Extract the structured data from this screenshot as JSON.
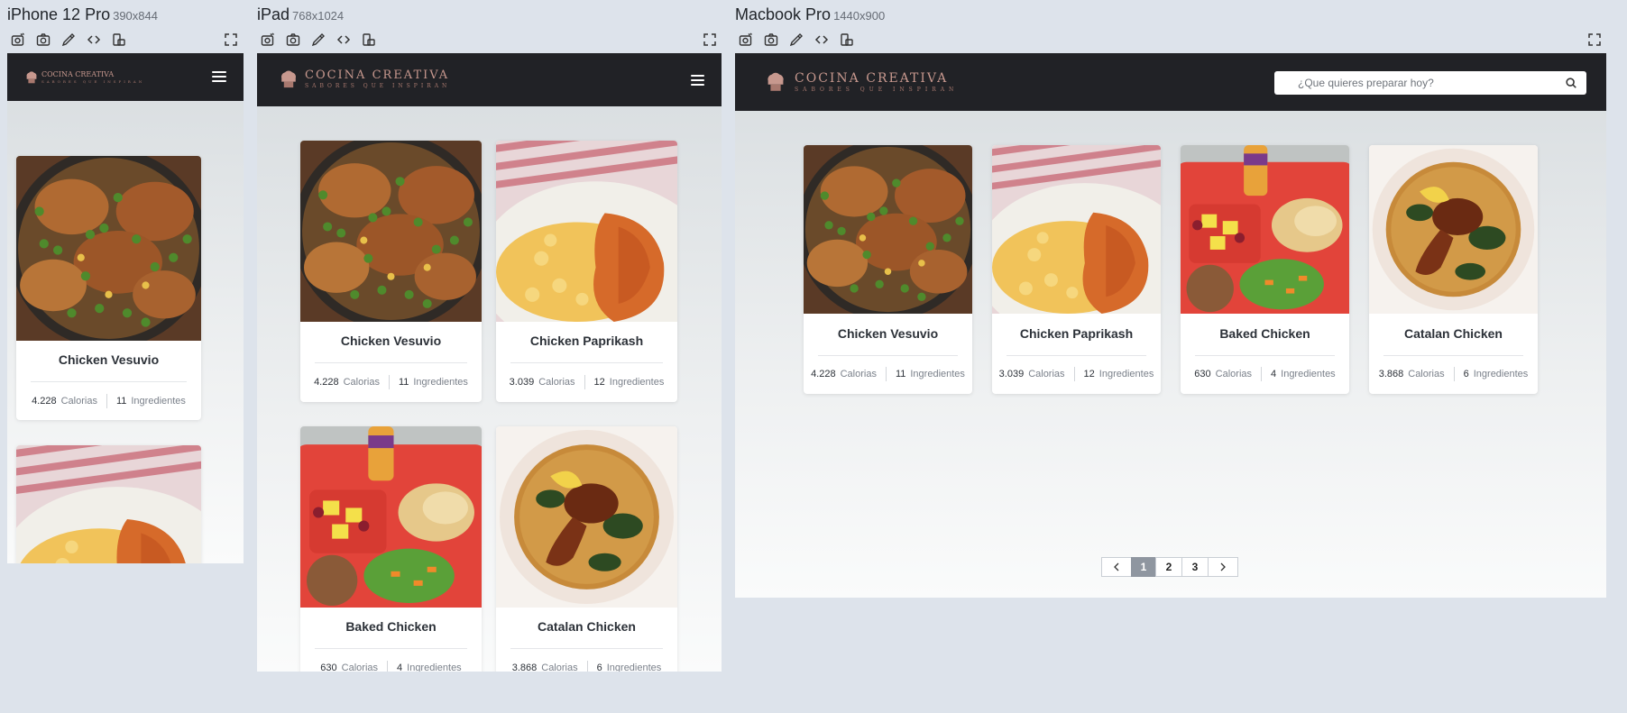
{
  "panels": [
    {
      "device": "iPhone 12 Pro",
      "resolution": "390x844"
    },
    {
      "device": "iPad",
      "resolution": "768x1024"
    },
    {
      "device": "Macbook Pro",
      "resolution": "1440x900"
    }
  ],
  "toolbar_icons": [
    "camera-settings-icon",
    "screenshot-icon",
    "eyedropper-icon",
    "code-icon",
    "rotate-device-icon",
    "fullscreen-icon"
  ],
  "site": {
    "logo_text": "COCINA CREATIVA",
    "tagline": "SABORES QUE INSPIRAN",
    "search_placeholder": "¿Que quieres preparar hoy?"
  },
  "recipes": [
    {
      "name": "Chicken Vesuvio",
      "calories": "4.228",
      "calories_label": "Calorias",
      "ingredients": "11",
      "ingredients_label": "Ingredientes",
      "image": "chicken-vesuvio-photo"
    },
    {
      "name": "Chicken Paprikash",
      "calories": "3.039",
      "calories_label": "Calorias",
      "ingredients": "12",
      "ingredients_label": "Ingredientes",
      "image": "chicken-paprikash-photo"
    },
    {
      "name": "Baked Chicken",
      "calories": "630",
      "calories_label": "Calorias",
      "ingredients": "4",
      "ingredients_label": "Ingredientes",
      "image": "baked-chicken-photo"
    },
    {
      "name": "Catalan Chicken",
      "calories": "3.868",
      "calories_label": "Calorias",
      "ingredients": "6",
      "ingredients_label": "Ingredientes",
      "image": "catalan-chicken-photo"
    }
  ],
  "pagination": {
    "pages": [
      "1",
      "2",
      "3"
    ],
    "active": "1",
    "prev_icon": "chevron-left-icon",
    "next_icon": "chevron-right-icon"
  },
  "colors": {
    "navbar": "#212226",
    "logo": "#c7988e",
    "background": "#dde3eb",
    "active_page": "#8f96a0"
  }
}
